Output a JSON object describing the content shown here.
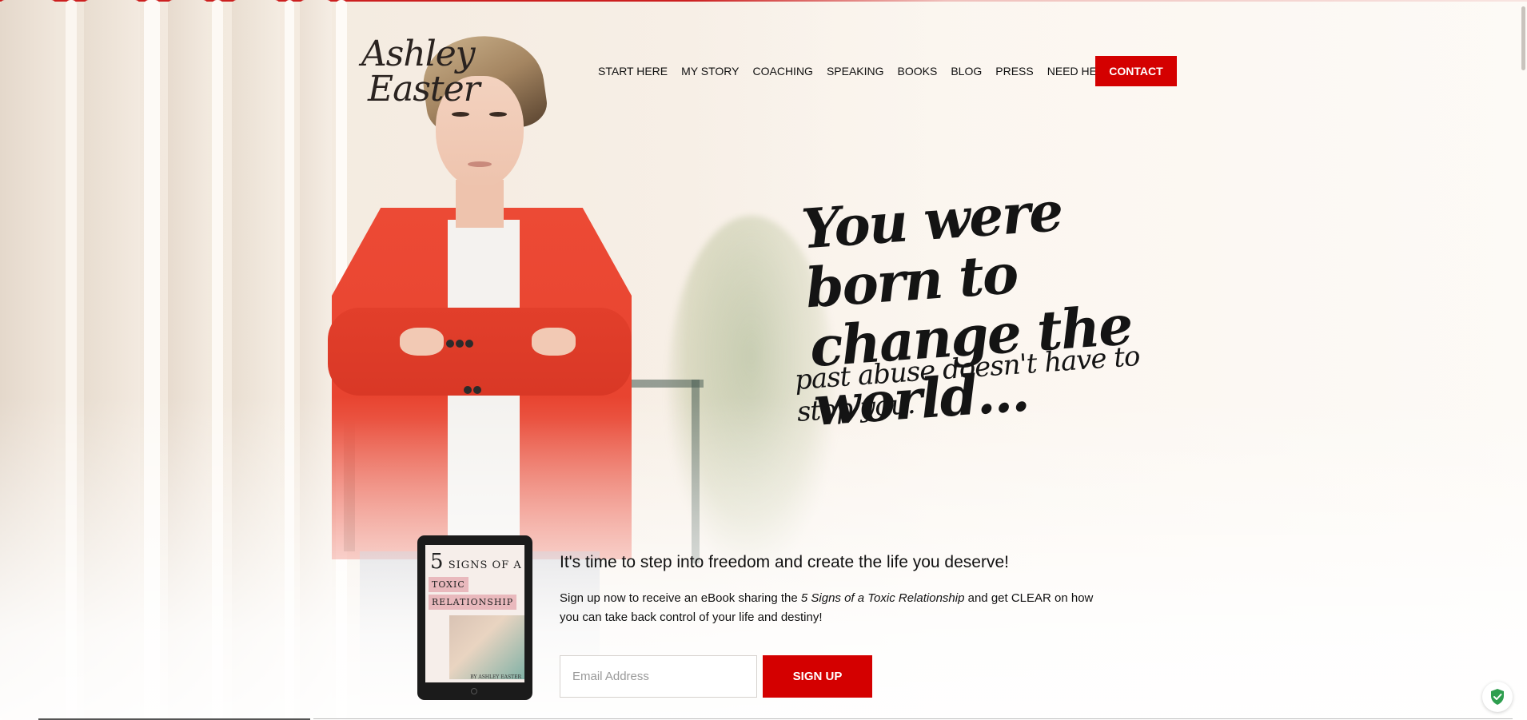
{
  "logo": {
    "line1": "Ashley",
    "line2": "Easter"
  },
  "nav": {
    "items": [
      "START HERE",
      "MY STORY",
      "COACHING",
      "SPEAKING",
      "BOOKS",
      "BLOG",
      "PRESS",
      "NEED HELP?"
    ],
    "contact": "CONTACT"
  },
  "hero": {
    "headline_line1": "You were born to",
    "headline_line2": "change the world...",
    "subline": "past abuse doesn't have to stop you."
  },
  "ebook": {
    "number": "5",
    "title_word": "SIGNS OF A",
    "tag1": "TOXIC",
    "tag2": "RELATIONSHIP",
    "author": "BY ASHLEY EASTER"
  },
  "optin": {
    "title": "It's time to step into freedom and create the life you deserve!",
    "body_before": "Sign up now to receive an eBook sharing the ",
    "body_italic": "5 Signs of a Toxic Relationship",
    "body_after": " and get CLEAR on how you can take back control of your life and destiny!",
    "email_placeholder": "Email Address",
    "submit": "SIGN UP"
  },
  "colors": {
    "accent": "#d40000",
    "jacket": "#e8432f",
    "security_badge": "#2e9e4f"
  },
  "icons": {
    "security": "shield-check-icon"
  }
}
